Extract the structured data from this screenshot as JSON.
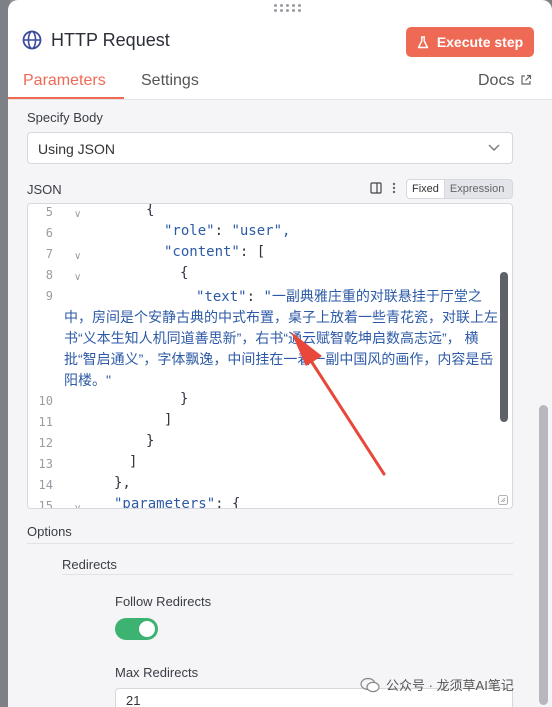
{
  "window": {
    "title": "HTTP Request",
    "execute_label": "Execute step"
  },
  "tabs": [
    {
      "label": "Parameters",
      "active": true
    },
    {
      "label": "Settings",
      "active": false
    },
    {
      "label": "Docs",
      "active": false
    }
  ],
  "body": {
    "specify_label": "Specify Body",
    "specify_value": "Using JSON",
    "json_label": "JSON",
    "mode_fixed": "Fixed",
    "mode_expression": "Expression"
  },
  "editor": {
    "line_numbers": [
      "5",
      "6",
      "7",
      "8",
      "9",
      "10",
      "11",
      "12",
      "13",
      "14",
      "15"
    ],
    "lines": {
      "l5": "{",
      "l6_key": "\"role\"",
      "l6_val": "\"user\",",
      "l7_key": "\"content\"",
      "l7_val": "[",
      "l8": "{",
      "l9_key": "\"text\"",
      "l9_val_first": "\"一副典雅庄重的对联悬挂于厅堂之",
      "l9_wrap": "中，房间是个安静古典的中式布置，桌子上放着一些青花瓷，对联上左书“义本生知人机同道善思新”，右书“通云赋智乾坤启数高志远”，  横批“智启通义”，字体飘逸，中间挂在一着一副中国风的画作，内容是岳阳楼。\"",
      "l10": "}",
      "l11": "]",
      "l12": "}",
      "l13": "]",
      "l14": "},",
      "l15_key": "\"parameters\"",
      "l15_val": "{"
    }
  },
  "options": {
    "label": "Options",
    "redirects_label": "Redirects",
    "follow_label": "Follow Redirects",
    "follow_enabled": true,
    "max_label": "Max Redirects",
    "max_value": "21"
  },
  "watermark": "公众号 · 龙须草AI笔记",
  "colors": {
    "accent": "#ef6a55",
    "toggle_on": "#3cb371",
    "code_blue": "#2d5aa6",
    "arrow": "#e8473a"
  }
}
